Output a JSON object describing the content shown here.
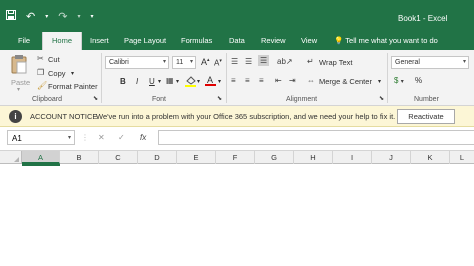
{
  "app": {
    "title": "Book1 - Excel"
  },
  "tabs": [
    {
      "label": "File"
    },
    {
      "label": "Home"
    },
    {
      "label": "Insert"
    },
    {
      "label": "Page Layout"
    },
    {
      "label": "Formulas"
    },
    {
      "label": "Data"
    },
    {
      "label": "Review"
    },
    {
      "label": "View"
    }
  ],
  "tell_me": "Tell me what you want to do",
  "clipboard": {
    "paste": "Paste",
    "cut": "Cut",
    "copy": "Copy",
    "format_painter": "Format Painter",
    "group": "Clipboard"
  },
  "font": {
    "name": "Calibri",
    "size": "11",
    "bold": "B",
    "italic": "I",
    "underline": "U",
    "grow": "A",
    "shrink": "A",
    "group": "Font"
  },
  "alignment": {
    "wrap": "Wrap Text",
    "merge": "Merge & Center",
    "group": "Alignment"
  },
  "number": {
    "format": "General",
    "currency": "$",
    "percent": "%",
    "group": "Number"
  },
  "notice": {
    "heading": "ACCOUNT NOTICE",
    "message": "We've run into a problem with your Office 365 subscription, and we need your help to fix it.",
    "button": "Reactivate"
  },
  "formula_bar": {
    "name_box": "A1",
    "cancel": "✕",
    "enter": "✓",
    "fx": "fx"
  },
  "columns": [
    "A",
    "B",
    "C",
    "D",
    "E",
    "F",
    "G",
    "H",
    "I",
    "J",
    "K",
    "L"
  ],
  "colors": {
    "excel_green": "#217346",
    "notice_bg": "#fcf6d6"
  }
}
